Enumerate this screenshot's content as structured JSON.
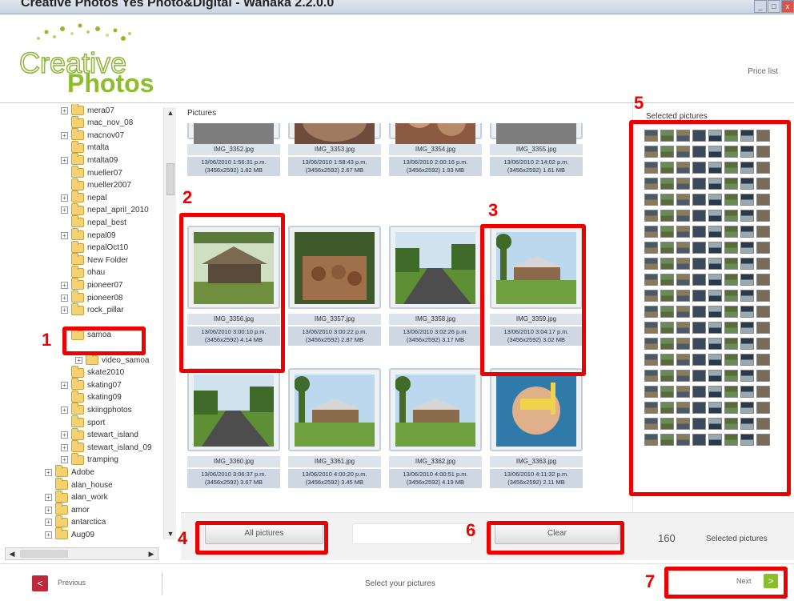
{
  "window": {
    "title": "Creative Photos Yes Photo&Digital - Wanaka 2.2.0.0"
  },
  "header": {
    "logo_top": "Creative",
    "logo_bottom": "Photos",
    "price_list": "Price list"
  },
  "tree": {
    "items": [
      {
        "label": "mera07",
        "indent": 1,
        "expander": true
      },
      {
        "label": "mac_nov_08",
        "indent": 1,
        "expander": false
      },
      {
        "label": "macnov07",
        "indent": 1,
        "expander": true
      },
      {
        "label": "mtalta",
        "indent": 1,
        "expander": false
      },
      {
        "label": "mtalta09",
        "indent": 1,
        "expander": true
      },
      {
        "label": "mueller07",
        "indent": 1,
        "expander": false
      },
      {
        "label": "mueller2007",
        "indent": 1,
        "expander": false
      },
      {
        "label": "nepal",
        "indent": 1,
        "expander": true
      },
      {
        "label": "nepal_april_2010",
        "indent": 1,
        "expander": true
      },
      {
        "label": "nepal_best",
        "indent": 1,
        "expander": false
      },
      {
        "label": "nepal09",
        "indent": 1,
        "expander": true
      },
      {
        "label": "nepalOct10",
        "indent": 1,
        "expander": false
      },
      {
        "label": "New Folder",
        "indent": 1,
        "expander": false
      },
      {
        "label": "ohau",
        "indent": 1,
        "expander": false
      },
      {
        "label": "pioneer07",
        "indent": 1,
        "expander": true
      },
      {
        "label": "pioneer08",
        "indent": 1,
        "expander": true
      },
      {
        "label": "rock_pillar",
        "indent": 1,
        "expander": true
      },
      {
        "label": "",
        "indent": 1,
        "expander": false
      },
      {
        "label": "samoa",
        "indent": 1,
        "expander": false
      },
      {
        "label": "",
        "indent": 1,
        "expander": false
      },
      {
        "label": "video_samoa",
        "indent": 2,
        "expander": true
      },
      {
        "label": "skate2010",
        "indent": 1,
        "expander": false
      },
      {
        "label": "skating07",
        "indent": 1,
        "expander": true
      },
      {
        "label": "skating09",
        "indent": 1,
        "expander": false
      },
      {
        "label": "skiingphotos",
        "indent": 1,
        "expander": true
      },
      {
        "label": "sport",
        "indent": 1,
        "expander": false
      },
      {
        "label": "stewart_island",
        "indent": 1,
        "expander": true
      },
      {
        "label": "stewart_island_09",
        "indent": 1,
        "expander": true
      },
      {
        "label": "tramping",
        "indent": 1,
        "expander": true
      },
      {
        "label": "Adobe",
        "indent": 0,
        "expander": true
      },
      {
        "label": "alan_house",
        "indent": 0,
        "expander": false
      },
      {
        "label": "alan_work",
        "indent": 0,
        "expander": true
      },
      {
        "label": "amor",
        "indent": 0,
        "expander": true
      },
      {
        "label": "antarctica",
        "indent": 0,
        "expander": true
      },
      {
        "label": "Aug09",
        "indent": 0,
        "expander": true
      }
    ]
  },
  "pictures": {
    "title": "Pictures",
    "photos": [
      {
        "name": "IMG_3352.jpg",
        "date": "13/06/2010 1:56:31 p.m.",
        "info": "(3456x2592) 1.82 MB",
        "scene": "dark"
      },
      {
        "name": "IMG_3353.jpg",
        "date": "13/06/2010 1:58:43 p.m.",
        "info": "(3456x2592) 2.67 MB",
        "scene": "brown"
      },
      {
        "name": "IMG_3354.jpg",
        "date": "13/06/2010 2:00:16 p.m.",
        "info": "(3456x2592) 1.93 MB",
        "scene": "people"
      },
      {
        "name": "IMG_3355.jpg",
        "date": "13/06/2010 2:14:02 p.m.",
        "info": "(3456x2592) 1.61 MB",
        "scene": "dark"
      },
      {
        "name": "IMG_3356.jpg",
        "date": "13/06/2010 3:00:10 p.m.",
        "info": "(3456x2592) 4.14 MB",
        "scene": "hut"
      },
      {
        "name": "IMG_3357.jpg",
        "date": "13/06/2010 3:00:22 p.m.",
        "info": "(3456x2592) 2.87 MB",
        "scene": "coconut"
      },
      {
        "name": "IMG_3358.jpg",
        "date": "13/06/2010 3:02:26 p.m.",
        "info": "(3456x2592) 3.17 MB",
        "scene": "road"
      },
      {
        "name": "IMG_3359.jpg",
        "date": "13/06/2010 3:04:17 p.m.",
        "info": "(3456x2592) 3.02 MB",
        "scene": "house"
      },
      {
        "name": "IMG_3360.jpg",
        "date": "13/06/2010 3:06:37 p.m.",
        "info": "(3456x2592) 3.67 MB",
        "scene": "road"
      },
      {
        "name": "IMG_3361.jpg",
        "date": "13/06/2010 4:00:20 p.m.",
        "info": "(3456x2592) 3.45 MB",
        "scene": "house"
      },
      {
        "name": "IMG_3362.jpg",
        "date": "13/06/2010 4:00:51 p.m.",
        "info": "(3456x2592) 4.19 MB",
        "scene": "house"
      },
      {
        "name": "IMG_3363.jpg",
        "date": "13/06/2010 4:11:32 p.m.",
        "info": "(3456x2592) 2.11 MB",
        "scene": "snorkel"
      }
    ]
  },
  "selected": {
    "title": "Selected pictures",
    "count": "160",
    "count_label": "Selected pictures"
  },
  "buttons": {
    "all_pictures": "All pictures",
    "clear": "Clear"
  },
  "footer": {
    "previous": "Previous",
    "status": "Select your pictures",
    "next": "Next"
  },
  "callouts": [
    "1",
    "2",
    "3",
    "4",
    "5",
    "6",
    "7"
  ],
  "colors": {
    "callout": "#e00000",
    "brand_green": "#8cbd2a",
    "prev_red": "#c0283a"
  },
  "icons": {
    "tree_expander": "plus-icon",
    "folder": "folder-icon",
    "previous": "chevron-left-icon",
    "next": "chevron-right-icon"
  }
}
